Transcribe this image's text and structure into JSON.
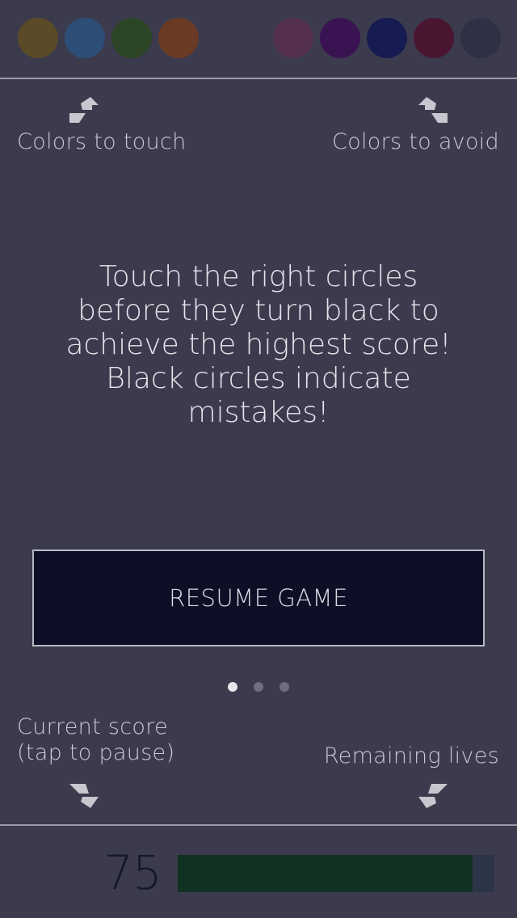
{
  "colors_to_touch": [
    {
      "name": "olive",
      "hex": "#5a4a28"
    },
    {
      "name": "blue",
      "hex": "#2d4e76"
    },
    {
      "name": "green",
      "hex": "#2c4526"
    },
    {
      "name": "rust",
      "hex": "#6a3a25"
    }
  ],
  "colors_to_avoid": [
    {
      "name": "plum",
      "hex": "#54304d"
    },
    {
      "name": "purple",
      "hex": "#3a1352"
    },
    {
      "name": "navy",
      "hex": "#161b52"
    },
    {
      "name": "maroon",
      "hex": "#4a1530"
    },
    {
      "name": "slate",
      "hex": "#2f3043"
    }
  ],
  "labels": {
    "colors_to_touch": "Colors to touch",
    "colors_to_avoid": "Colors to avoid",
    "current_score_line1": "Current score",
    "current_score_line2": "(tap to pause)",
    "remaining_lives": "Remaining lives"
  },
  "instructions": [
    "Touch the right circles",
    "before they turn black to",
    "achieve the highest score!",
    "Black circles indicate",
    "mistakes!"
  ],
  "resume_button": "RESUME GAME",
  "pager": {
    "count": 3,
    "active_index": 0
  },
  "score": "75",
  "lives_fraction": 0.93,
  "icons": {
    "touch_arrow": "arrow-up-right-icon",
    "avoid_arrow": "arrow-up-left-icon",
    "score_arrow": "arrow-down-right-icon",
    "lives_arrow": "arrow-down-left-icon"
  },
  "theme": {
    "background": "#3c3b4d",
    "button_bg": "#0e0e26",
    "lives_fill": "#113222",
    "lives_track": "#2c3548"
  }
}
